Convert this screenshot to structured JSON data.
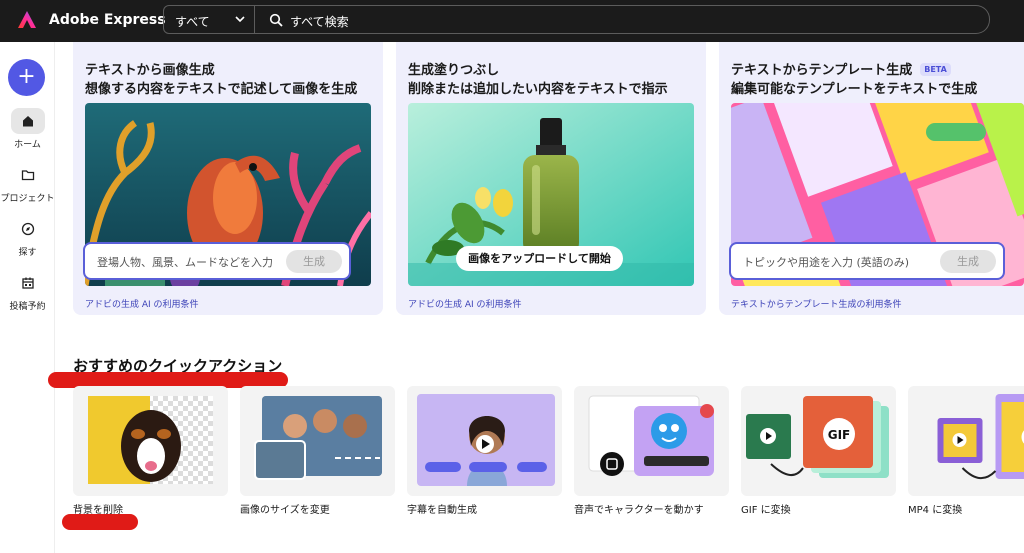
{
  "app": {
    "brand": "Adobe Express"
  },
  "search": {
    "scope": "すべて",
    "placeholder": "すべて検索"
  },
  "sidebar": {
    "create_symbol": "+",
    "items": [
      {
        "label": "ホーム",
        "icon": "home-icon",
        "active": true
      },
      {
        "label": "プロジェクト",
        "icon": "folder-icon",
        "active": false
      },
      {
        "label": "探す",
        "icon": "compass-icon",
        "active": false
      },
      {
        "label": "投稿予約",
        "icon": "calendar-icon",
        "active": false
      }
    ]
  },
  "features": [
    {
      "title": "テキストから画像生成",
      "subtitle": "想像する内容をテキストで記述して画像を生成",
      "prompt_placeholder": "登場人物、風景、ムードなどを入力",
      "button": "生成",
      "legal": "アドビの生成 AI の利用条件"
    },
    {
      "title": "生成塗りつぶし",
      "subtitle": "削除または追加したい内容をテキストで指示",
      "button": "画像をアップロードして開始",
      "legal": "アドビの生成 AI の利用条件"
    },
    {
      "title": "テキストからテンプレート生成",
      "badge": "BETA",
      "subtitle": "編集可能なテンプレートをテキストで生成",
      "prompt_placeholder": "トピックや用途を入力 (英語のみ)",
      "button": "生成",
      "legal": "テキストからテンプレート生成の利用条件"
    }
  ],
  "quick_actions": {
    "title": "おすすめのクイックアクション",
    "items": [
      {
        "label": "背景を削除"
      },
      {
        "label": "画像のサイズを変更"
      },
      {
        "label": "字幕を自動生成"
      },
      {
        "label": "音声でキャラクターを動かす"
      },
      {
        "label": "GIF に変換",
        "thumb_text": "GIF"
      },
      {
        "label": "MP4 に変換"
      }
    ]
  },
  "colors": {
    "accent": "#5258e4",
    "topbar": "#1b1b1b",
    "card_bg": "#efeffc",
    "annotation_red": "#e01b17"
  }
}
